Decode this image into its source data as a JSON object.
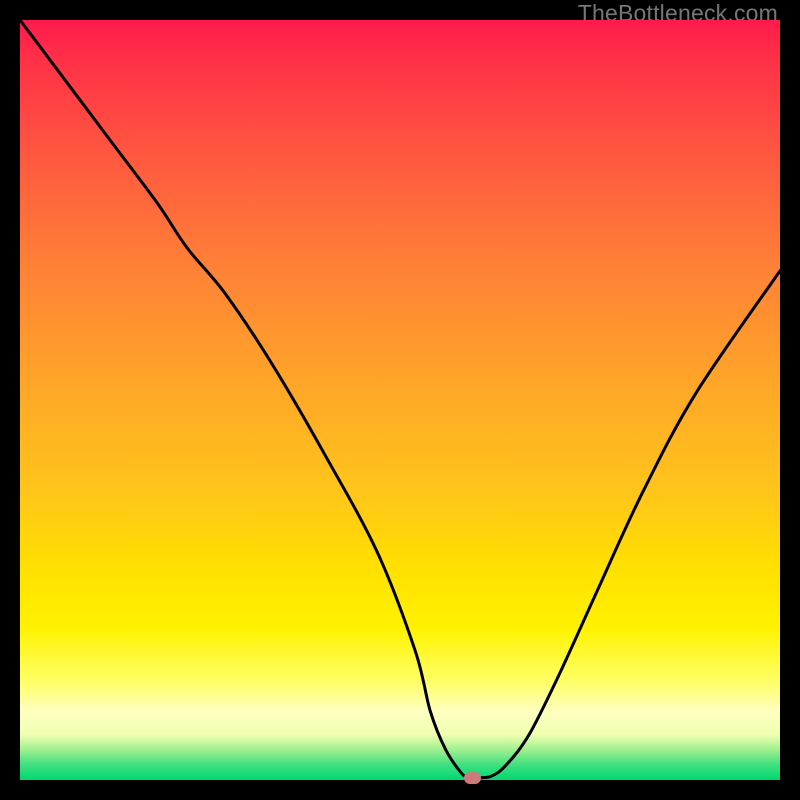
{
  "watermark": "TheBottleneck.com",
  "chart_data": {
    "type": "line",
    "title": "",
    "xlabel": "",
    "ylabel": "",
    "xlim": [
      0,
      100
    ],
    "ylim": [
      0,
      100
    ],
    "series": [
      {
        "name": "curve",
        "x": [
          0,
          6,
          12,
          18,
          22,
          27,
          33,
          40,
          47,
          52,
          54,
          56,
          58,
          59,
          60,
          62,
          64,
          67,
          71,
          76,
          82,
          89,
          100
        ],
        "y": [
          100,
          92,
          84,
          76,
          70,
          64,
          55,
          43,
          30,
          17,
          9,
          4,
          1,
          0.3,
          0.3,
          0.5,
          2,
          6,
          14,
          25,
          38,
          51,
          67
        ]
      }
    ],
    "marker": {
      "x": 59.5,
      "y": 0.3
    },
    "colors": {
      "curve": "#000000",
      "marker": "#cc7a7a",
      "gradient_top": "#ff1a4d",
      "gradient_bottom": "#00d870"
    }
  }
}
